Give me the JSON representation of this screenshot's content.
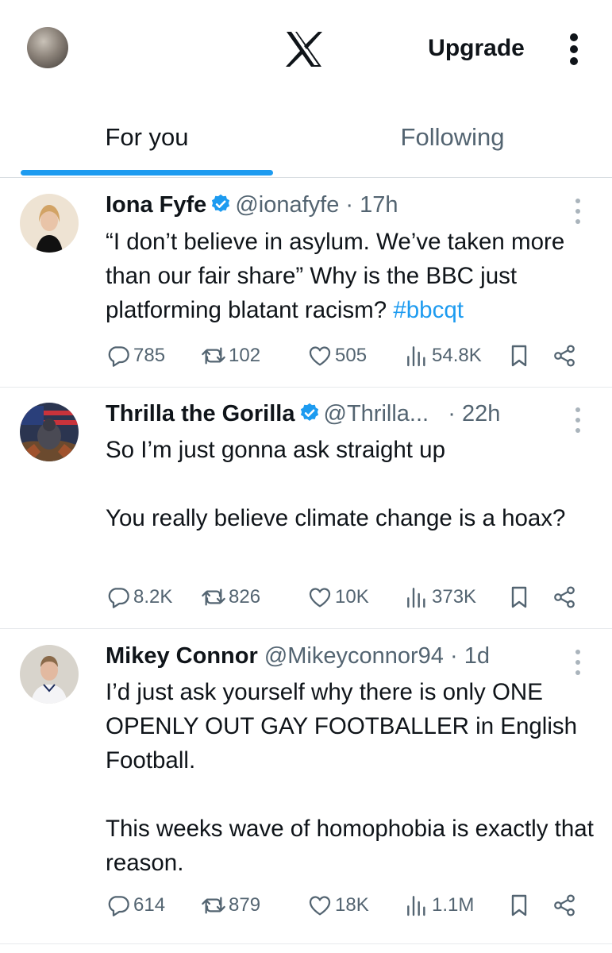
{
  "header": {
    "logo_icon": "x-logo-icon",
    "upgrade_label": "Upgrade",
    "more_icon": "vertical-ellipsis-icon"
  },
  "tabs": [
    {
      "label": "For you",
      "selected": true
    },
    {
      "label": "Following",
      "selected": false
    }
  ],
  "colors": {
    "accent": "#1d9bf0",
    "text": "#0f1419",
    "muted": "#536471"
  },
  "tweets": [
    {
      "name": "Iona Fyfe",
      "verified": true,
      "handle": "@ionafyfe",
      "time": "· 17h",
      "text": "“I don’t believe in asylum. We’ve taken more than our fair share” Why is the BBC just platforming blatant racism? ",
      "hashtag": "#bbcqt",
      "replies": "785",
      "reposts": "102",
      "likes": "505",
      "views": "54.8K"
    },
    {
      "name": "Thrilla the Gorilla",
      "verified": true,
      "handle": "@Thrilla...",
      "time": "· 22h",
      "text": "So I’m just gonna ask straight up\n\nYou really believe climate change is a hoax?",
      "replies": "8.2K",
      "reposts": "826",
      "likes": "10K",
      "views": "373K"
    },
    {
      "name": "Mikey Connor",
      "verified": false,
      "handle": "@Mikeyconnor94",
      "time": "· 1d",
      "text": "I’d just ask yourself why there is only ONE OPENLY OUT GAY FOOTBALLER in English Football.\n\nThis weeks wave of homophobia is exactly that reason.",
      "replies": "614",
      "reposts": "879",
      "likes": "18K",
      "views": "1.1M"
    }
  ]
}
